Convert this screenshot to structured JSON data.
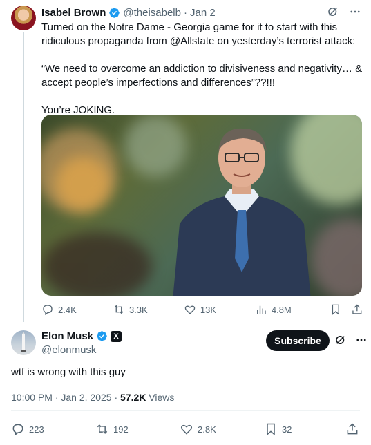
{
  "quoted_tweet": {
    "author_name": "Isabel Brown",
    "author_handle": "@theisabelb",
    "dot": "·",
    "date": "Jan 2",
    "paragraphs": [
      "Turned on the Notre Dame - Georgia game for it to start with this ridiculous propaganda from @Allstate on yesterday’s terrorist attack:",
      "“We need to overcome an addiction to divisiveness and negativity… & accept people’s imperfections and differences”??!!!",
      "You’re JOKING."
    ],
    "stats": {
      "replies": "2.4K",
      "reposts": "3.3K",
      "likes": "13K",
      "views": "4.8M"
    }
  },
  "main_tweet": {
    "author_name": "Elon Musk",
    "author_handle": "@elonmusk",
    "affiliate_badge": "X",
    "subscribe_label": "Subscribe",
    "text": "wtf is wrong with this guy",
    "time": "10:00 PM",
    "date": "Jan 2, 2025",
    "view_count": "57.2K",
    "views_label": "Views",
    "stats": {
      "replies": "223",
      "reposts": "192",
      "likes": "2.8K",
      "bookmarks": "32"
    }
  },
  "colors": {
    "text": "#0f1419",
    "secondary": "#536471",
    "verified": "#1d9bf0",
    "divider": "#eff3f4"
  },
  "icons": [
    "verified-icon",
    "grok-icon",
    "more-icon",
    "reply-icon",
    "repost-icon",
    "like-icon",
    "views-icon",
    "bookmark-icon",
    "share-icon"
  ]
}
